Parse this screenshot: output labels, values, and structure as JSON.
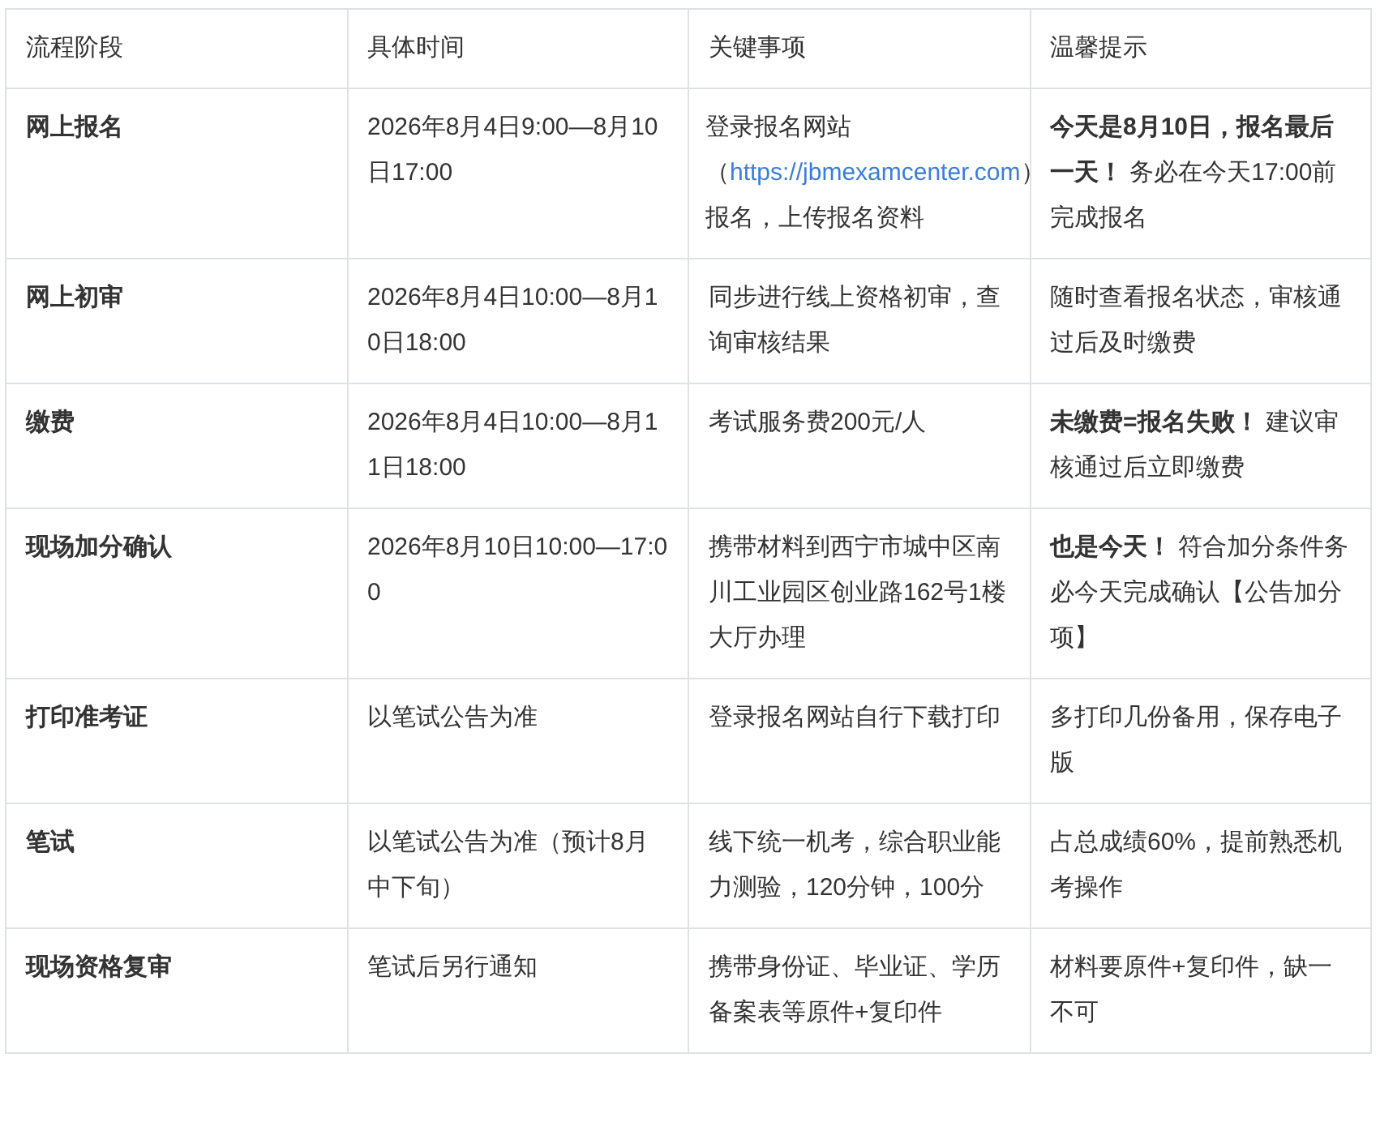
{
  "table": {
    "columns": [
      "流程阶段",
      "具体时间",
      "关键事项",
      "温馨提示"
    ],
    "rows": [
      {
        "phase": "网上报名",
        "time": "2026年8月4日9:00—8月10日17:00",
        "matter": {
          "before": "登录报名网站（",
          "link": "https://jbmexamcenter.com",
          "after": "）报名，上传报名资料"
        },
        "tip": "**今天是8月10日，报名最后一天！** 务必在今天17:00前完成报名"
      },
      {
        "phase": "网上初审",
        "time": "2026年8月4日10:00—8月10日18:00",
        "matter": {
          "before": "同步进行线上资格初审，查询审核结果"
        },
        "tip": "随时查看报名状态，审核通过后及时缴费"
      },
      {
        "phase": "缴费",
        "time": "2026年8月4日10:00—8月11日18:00",
        "matter": {
          "before": "考试服务费200元/人"
        },
        "tip": "**未缴费=报名失败！** 建议审核通过后立即缴费"
      },
      {
        "phase": "现场加分确认",
        "time": "2026年8月10日10:00—17:00",
        "matter": {
          "before": "携带材料到西宁市城中区南川工业园区创业路162号1楼大厅办理"
        },
        "tip": "**也是今天！** 符合加分条件务必今天完成确认【公告加分项】"
      },
      {
        "phase": "打印准考证",
        "time": "以笔试公告为准",
        "matter": {
          "before": "登录报名网站自行下载打印"
        },
        "tip": "多打印几份备用，保存电子版"
      },
      {
        "phase": "笔试",
        "time": "以笔试公告为准（预计8月中下旬）",
        "matter": {
          "before": "线下统一机考，综合职业能力测验，120分钟，100分"
        },
        "tip": "占总成绩60%，提前熟悉机考操作"
      },
      {
        "phase": "现场资格复审",
        "time": "笔试后另行通知",
        "matter": {
          "before": "携带身份证、毕业证、学历备案表等原件+复印件"
        },
        "tip": "材料要原件+复印件，缺一不可"
      }
    ]
  }
}
